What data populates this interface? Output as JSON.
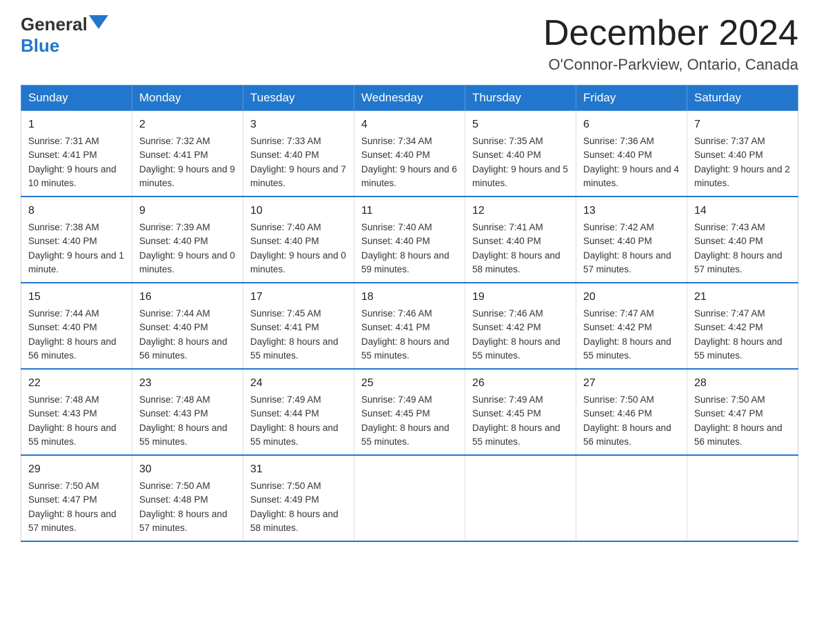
{
  "header": {
    "logo_general": "General",
    "logo_blue": "Blue",
    "month_title": "December 2024",
    "location": "O'Connor-Parkview, Ontario, Canada"
  },
  "days_of_week": [
    "Sunday",
    "Monday",
    "Tuesday",
    "Wednesday",
    "Thursday",
    "Friday",
    "Saturday"
  ],
  "weeks": [
    [
      {
        "day": "1",
        "sunrise": "7:31 AM",
        "sunset": "4:41 PM",
        "daylight": "9 hours and 10 minutes."
      },
      {
        "day": "2",
        "sunrise": "7:32 AM",
        "sunset": "4:41 PM",
        "daylight": "9 hours and 9 minutes."
      },
      {
        "day": "3",
        "sunrise": "7:33 AM",
        "sunset": "4:40 PM",
        "daylight": "9 hours and 7 minutes."
      },
      {
        "day": "4",
        "sunrise": "7:34 AM",
        "sunset": "4:40 PM",
        "daylight": "9 hours and 6 minutes."
      },
      {
        "day": "5",
        "sunrise": "7:35 AM",
        "sunset": "4:40 PM",
        "daylight": "9 hours and 5 minutes."
      },
      {
        "day": "6",
        "sunrise": "7:36 AM",
        "sunset": "4:40 PM",
        "daylight": "9 hours and 4 minutes."
      },
      {
        "day": "7",
        "sunrise": "7:37 AM",
        "sunset": "4:40 PM",
        "daylight": "9 hours and 2 minutes."
      }
    ],
    [
      {
        "day": "8",
        "sunrise": "7:38 AM",
        "sunset": "4:40 PM",
        "daylight": "9 hours and 1 minute."
      },
      {
        "day": "9",
        "sunrise": "7:39 AM",
        "sunset": "4:40 PM",
        "daylight": "9 hours and 0 minutes."
      },
      {
        "day": "10",
        "sunrise": "7:40 AM",
        "sunset": "4:40 PM",
        "daylight": "9 hours and 0 minutes."
      },
      {
        "day": "11",
        "sunrise": "7:40 AM",
        "sunset": "4:40 PM",
        "daylight": "8 hours and 59 minutes."
      },
      {
        "day": "12",
        "sunrise": "7:41 AM",
        "sunset": "4:40 PM",
        "daylight": "8 hours and 58 minutes."
      },
      {
        "day": "13",
        "sunrise": "7:42 AM",
        "sunset": "4:40 PM",
        "daylight": "8 hours and 57 minutes."
      },
      {
        "day": "14",
        "sunrise": "7:43 AM",
        "sunset": "4:40 PM",
        "daylight": "8 hours and 57 minutes."
      }
    ],
    [
      {
        "day": "15",
        "sunrise": "7:44 AM",
        "sunset": "4:40 PM",
        "daylight": "8 hours and 56 minutes."
      },
      {
        "day": "16",
        "sunrise": "7:44 AM",
        "sunset": "4:40 PM",
        "daylight": "8 hours and 56 minutes."
      },
      {
        "day": "17",
        "sunrise": "7:45 AM",
        "sunset": "4:41 PM",
        "daylight": "8 hours and 55 minutes."
      },
      {
        "day": "18",
        "sunrise": "7:46 AM",
        "sunset": "4:41 PM",
        "daylight": "8 hours and 55 minutes."
      },
      {
        "day": "19",
        "sunrise": "7:46 AM",
        "sunset": "4:42 PM",
        "daylight": "8 hours and 55 minutes."
      },
      {
        "day": "20",
        "sunrise": "7:47 AM",
        "sunset": "4:42 PM",
        "daylight": "8 hours and 55 minutes."
      },
      {
        "day": "21",
        "sunrise": "7:47 AM",
        "sunset": "4:42 PM",
        "daylight": "8 hours and 55 minutes."
      }
    ],
    [
      {
        "day": "22",
        "sunrise": "7:48 AM",
        "sunset": "4:43 PM",
        "daylight": "8 hours and 55 minutes."
      },
      {
        "day": "23",
        "sunrise": "7:48 AM",
        "sunset": "4:43 PM",
        "daylight": "8 hours and 55 minutes."
      },
      {
        "day": "24",
        "sunrise": "7:49 AM",
        "sunset": "4:44 PM",
        "daylight": "8 hours and 55 minutes."
      },
      {
        "day": "25",
        "sunrise": "7:49 AM",
        "sunset": "4:45 PM",
        "daylight": "8 hours and 55 minutes."
      },
      {
        "day": "26",
        "sunrise": "7:49 AM",
        "sunset": "4:45 PM",
        "daylight": "8 hours and 55 minutes."
      },
      {
        "day": "27",
        "sunrise": "7:50 AM",
        "sunset": "4:46 PM",
        "daylight": "8 hours and 56 minutes."
      },
      {
        "day": "28",
        "sunrise": "7:50 AM",
        "sunset": "4:47 PM",
        "daylight": "8 hours and 56 minutes."
      }
    ],
    [
      {
        "day": "29",
        "sunrise": "7:50 AM",
        "sunset": "4:47 PM",
        "daylight": "8 hours and 57 minutes."
      },
      {
        "day": "30",
        "sunrise": "7:50 AM",
        "sunset": "4:48 PM",
        "daylight": "8 hours and 57 minutes."
      },
      {
        "day": "31",
        "sunrise": "7:50 AM",
        "sunset": "4:49 PM",
        "daylight": "8 hours and 58 minutes."
      },
      null,
      null,
      null,
      null
    ]
  ]
}
